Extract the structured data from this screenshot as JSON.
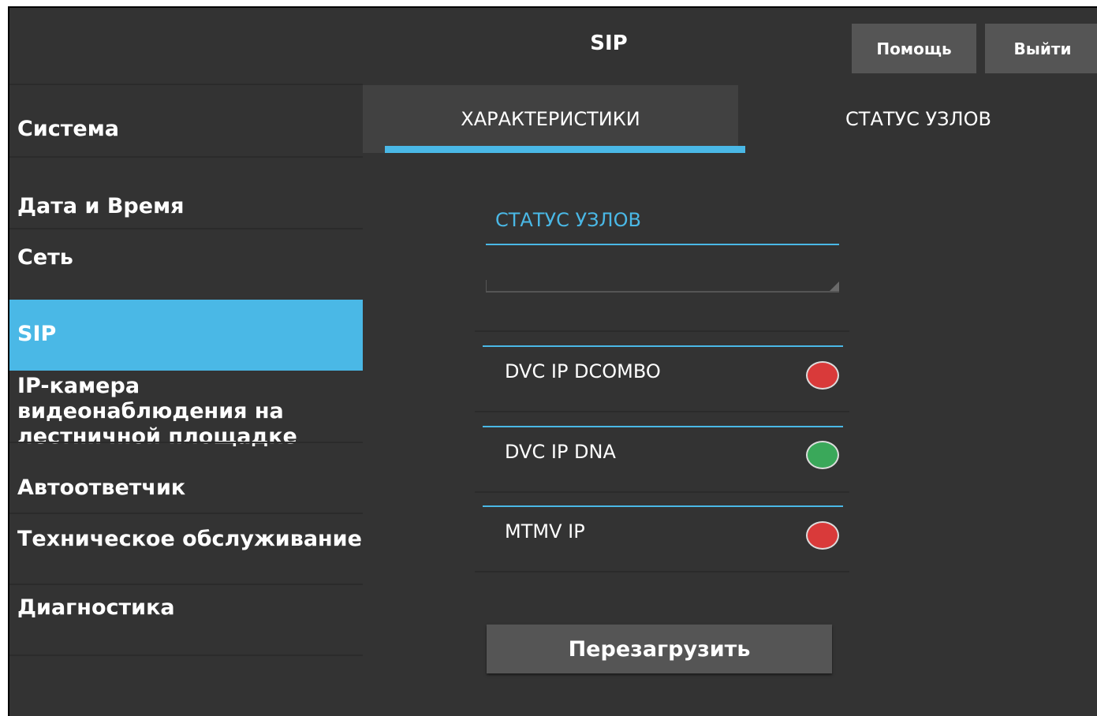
{
  "header": {
    "title": "SIP",
    "help_label": "Помощь",
    "exit_label": "Выйти"
  },
  "sidebar": {
    "items": [
      {
        "label": "Система"
      },
      {
        "label": "Дата и Время"
      },
      {
        "label": "Сеть"
      },
      {
        "label": "SIP",
        "active": true
      },
      {
        "label": "IP-камера видеонаблюдения на лестничной площадке"
      },
      {
        "label": "Автоответчик"
      },
      {
        "label": "Техническое обслуживание"
      },
      {
        "label": "Диагностика"
      }
    ]
  },
  "tabs": [
    {
      "label": "ХАРАКТЕРИСТИКИ",
      "active": false
    },
    {
      "label": "СТАТУС УЗЛОВ",
      "active": true
    }
  ],
  "section": {
    "title": "СТАТУС УЗЛОВ",
    "field_value": ""
  },
  "nodes": [
    {
      "name": "DVC IP DCOMBO",
      "status": "offline",
      "color": "#d93a3a"
    },
    {
      "name": "DVC IP DNA",
      "status": "online",
      "color": "#3aa85a"
    },
    {
      "name": "MTMV IP",
      "status": "offline",
      "color": "#d93a3a"
    }
  ],
  "actions": {
    "reboot_label": "Перезагрузить"
  },
  "colors": {
    "accent": "#4ab8e6",
    "background": "#333333",
    "button": "#555555"
  }
}
